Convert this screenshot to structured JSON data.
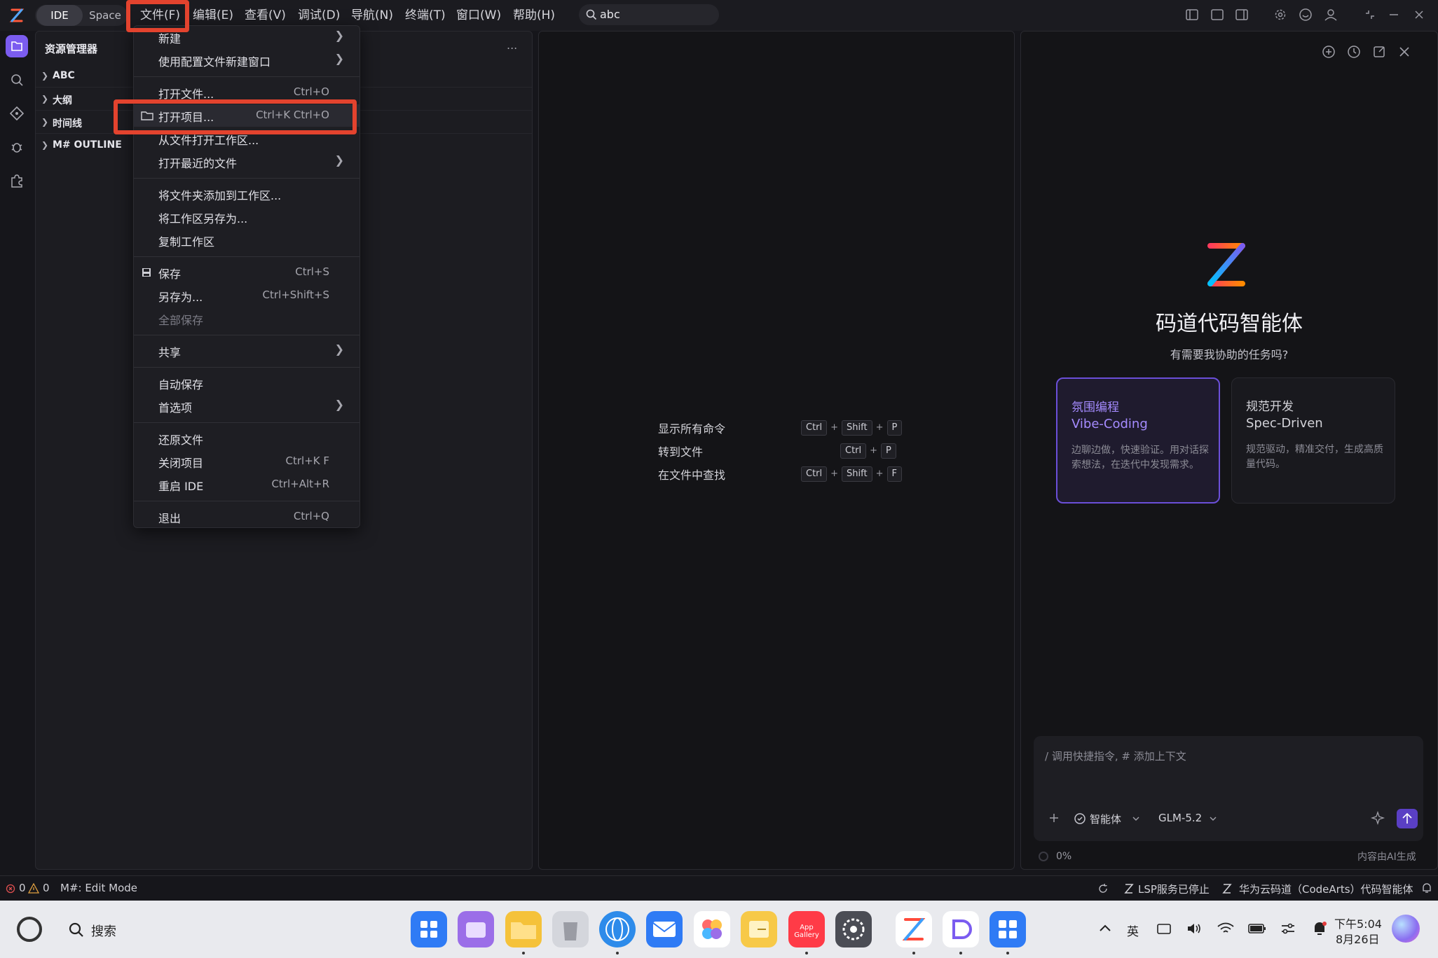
{
  "titlebar": {
    "mode_ide": "IDE",
    "mode_space": "Space",
    "menus": [
      "文件(F)",
      "编辑(E)",
      "查看(V)",
      "调试(D)",
      "导航(N)",
      "终端(T)",
      "窗口(W)",
      "帮助(H)"
    ],
    "search_value": "abc"
  },
  "explorer": {
    "title": "资源管理器",
    "more": "...",
    "items": [
      "ABC",
      "大纲",
      "时间线",
      "M# OUTLINE"
    ]
  },
  "file_menu": {
    "items": [
      {
        "label": "新建",
        "shortcut": "",
        "submenu": true
      },
      {
        "label": "使用配置文件新建窗口",
        "shortcut": "",
        "submenu": true
      },
      {
        "label": "打开文件...",
        "shortcut": "Ctrl+O"
      },
      {
        "label": "打开项目...",
        "shortcut": "Ctrl+K Ctrl+O"
      },
      {
        "label": "从文件打开工作区...",
        "shortcut": ""
      },
      {
        "label": "打开最近的文件",
        "shortcut": "",
        "submenu": true
      },
      {
        "label": "将文件夹添加到工作区...",
        "shortcut": ""
      },
      {
        "label": "将工作区另存为...",
        "shortcut": ""
      },
      {
        "label": "复制工作区",
        "shortcut": ""
      },
      {
        "label": "保存",
        "shortcut": "Ctrl+S"
      },
      {
        "label": "另存为...",
        "shortcut": "Ctrl+Shift+S"
      },
      {
        "label": "全部保存",
        "shortcut": ""
      },
      {
        "label": "共享",
        "shortcut": "",
        "submenu": true
      },
      {
        "label": "自动保存",
        "shortcut": ""
      },
      {
        "label": "首选项",
        "shortcut": "",
        "submenu": true
      },
      {
        "label": "还原文件",
        "shortcut": ""
      },
      {
        "label": "关闭项目",
        "shortcut": "Ctrl+K F"
      },
      {
        "label": "重启 IDE",
        "shortcut": "Ctrl+Alt+R"
      },
      {
        "label": "退出",
        "shortcut": "Ctrl+Q"
      }
    ]
  },
  "editor_hints": [
    {
      "label": "显示所有命令",
      "keys": [
        "Ctrl",
        "Shift",
        "P"
      ]
    },
    {
      "label": "转到文件",
      "keys": [
        "Ctrl",
        "P"
      ]
    },
    {
      "label": "在文件中查找",
      "keys": [
        "Ctrl",
        "Shift",
        "F"
      ]
    }
  ],
  "agent": {
    "title": "码道代码智能体",
    "subtitle": "有需要我协助的任务吗?",
    "cards": [
      {
        "t1": "氛围编程",
        "t2": "Vibe-Coding",
        "desc": "边聊边做，快速验证。用对话探索想法，在迭代中发现需求。"
      },
      {
        "t1": "规范开发",
        "t2": "Spec-Driven",
        "desc": "规范驱动，精准交付，生成高质量代码。"
      }
    ],
    "input_placeholder": "/ 调用快捷指令, # 添加上下文",
    "agent_label": "智能体",
    "model_label": "GLM-5.2",
    "progress": "0%",
    "ai_note": "内容由AI生成"
  },
  "statusbar": {
    "errors": "0",
    "warnings": "0",
    "mode": "M#: Edit Mode",
    "lsp": "LSP服务已停止",
    "agent_status": "华为云码道（CodeArts）代码智能体"
  },
  "taskbar": {
    "search_label": "搜索",
    "ime": "英",
    "time": "下午5:04",
    "date": "8月26日",
    "app_gallery_label": "App Gallery"
  },
  "colors": {
    "accent": "#7b5cf0",
    "highlight": "#e3432e"
  }
}
